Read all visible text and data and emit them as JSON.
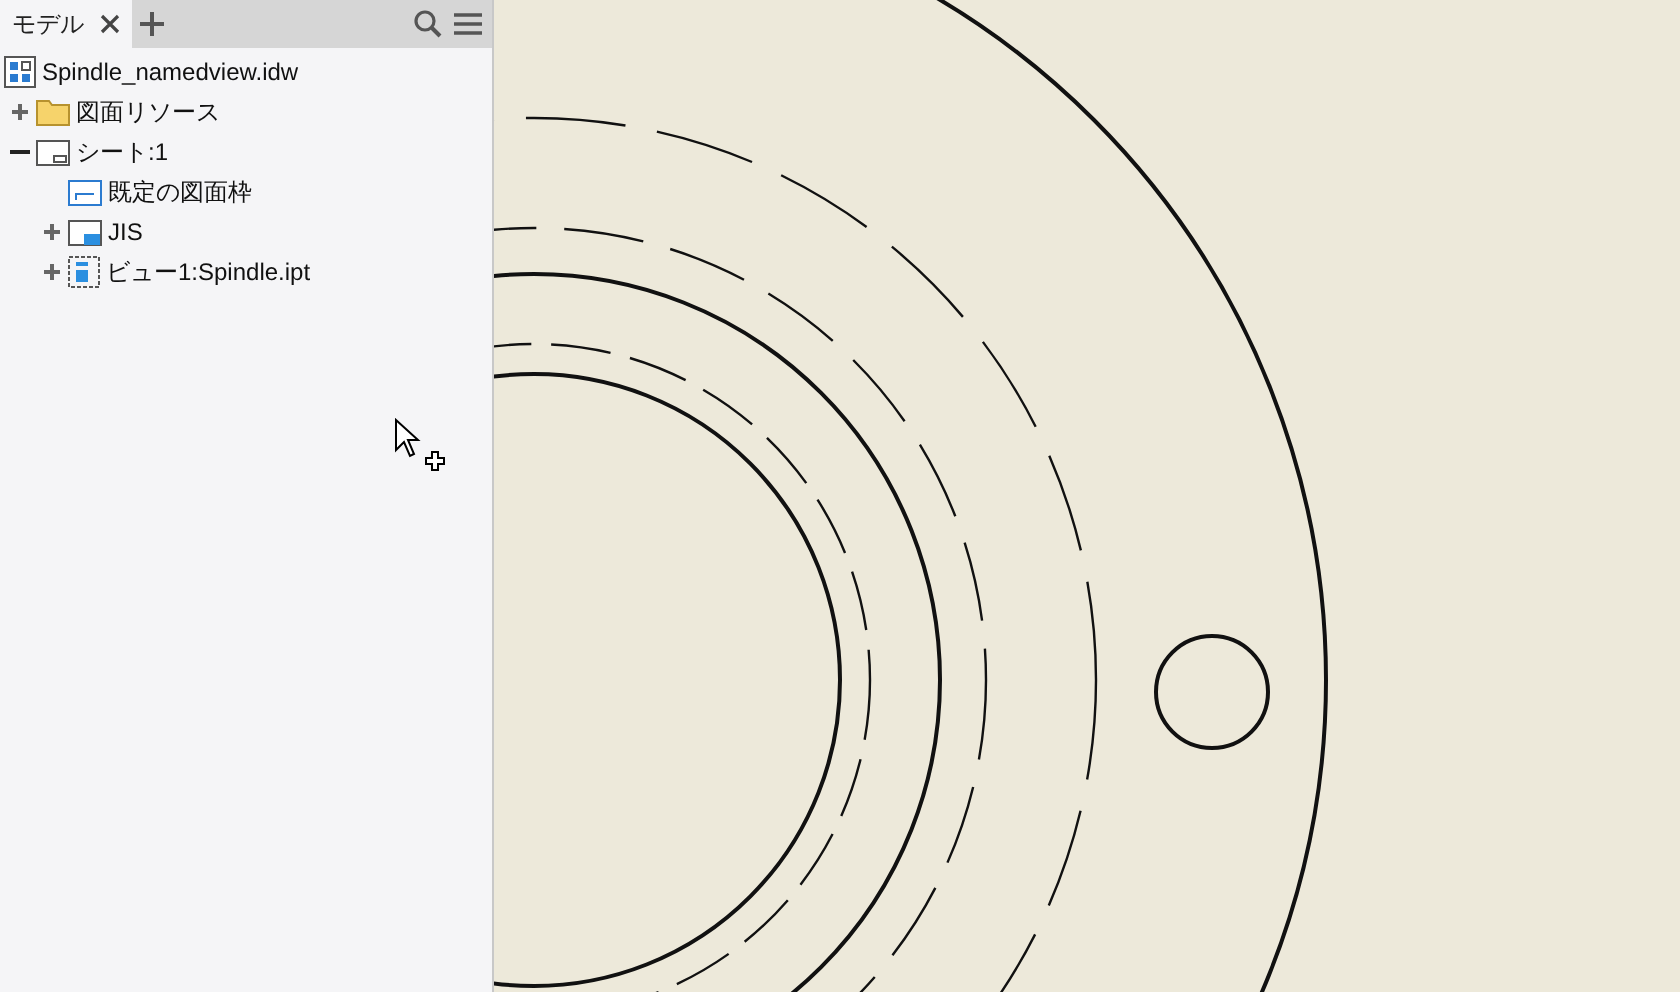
{
  "browser": {
    "tabs": [
      {
        "label": "モデル",
        "selected": true
      }
    ]
  },
  "tree": [
    {
      "label": "Spindle_namedview.idw",
      "kind": "drawing",
      "children": [
        {
          "label": "図面リソース",
          "kind": "folder",
          "expanded": false
        },
        {
          "label": "シート:1",
          "kind": "sheet",
          "expanded": true,
          "children": [
            {
              "label": "既定の図面枠",
              "kind": "border"
            },
            {
              "label": "JIS",
              "kind": "titleblock",
              "expanded": false
            },
            {
              "label": "ビュー1:Spindle.ipt",
              "kind": "view",
              "expanded": false
            }
          ]
        }
      ]
    }
  ]
}
